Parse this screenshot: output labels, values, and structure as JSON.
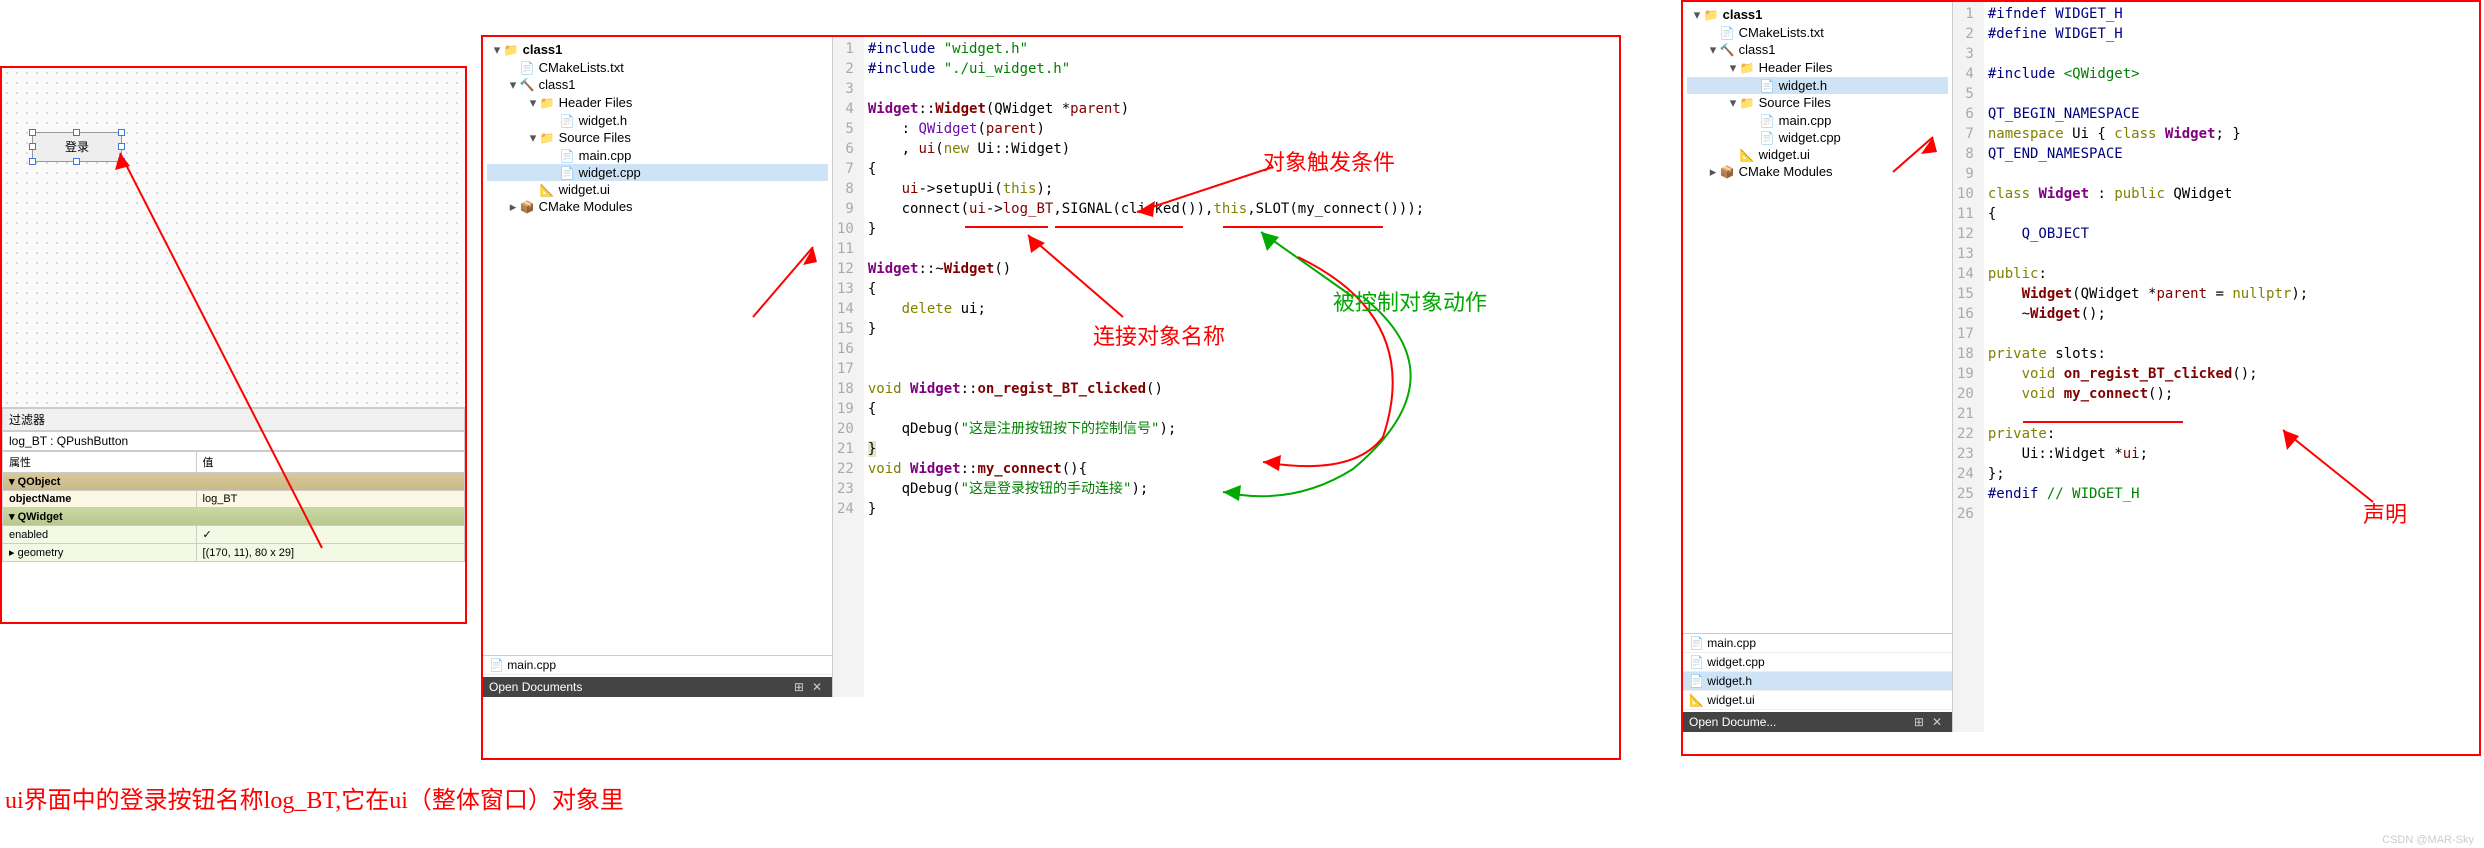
{
  "panel1": {
    "login_btn": "登录",
    "filter_label": "过滤器",
    "obj_line": "log_BT : QPushButton",
    "header_prop": "属性",
    "header_val": "值",
    "section_qobject": "QObject",
    "objectName_label": "objectName",
    "objectName_value": "log_BT",
    "section_qwidget": "QWidget",
    "enabled_label": "enabled",
    "enabled_value": "✓",
    "geometry_label": "geometry",
    "geometry_value": "[(170, 11), 80 x 29]"
  },
  "tree2": {
    "root": "class1",
    "cmakelists": "CMakeLists.txt",
    "sub": "class1",
    "headers": "Header Files",
    "widget_h": "widget.h",
    "sources": "Source Files",
    "main_cpp": "main.cpp",
    "widget_cpp": "widget.cpp",
    "widget_ui": "widget.ui",
    "cmake_modules": "CMake Modules"
  },
  "code_cpp": {
    "lines_gutter": "1\n2\n3\n4\n5\n6\n7\n8\n9\n10\n11\n12\n13\n14\n15\n16\n17\n18\n19\n20\n21\n22\n23\n24",
    "l1a": "#include ",
    "l1b": "\"widget.h\"",
    "l2a": "#include ",
    "l2b": "\"./ui_widget.h\"",
    "l4a": "Widget",
    "l4b": "::",
    "l4c": "Widget",
    "l4d": "(QWidget *",
    "l4e": "parent",
    "l4f": ")",
    "l5a": "    : ",
    "l5b": "QWidget",
    "l5c": "(",
    "l5d": "parent",
    "l5e": ")",
    "l6a": "    , ",
    "l6b": "ui",
    "l6c": "(",
    "l6d": "new",
    "l6e": " Ui::Widget)",
    "l7": "{",
    "l8a": "    ",
    "l8b": "ui",
    "l8c": "->setupUi(",
    "l8d": "this",
    "l8e": ");",
    "l9a": "    connect(",
    "l9b": "ui",
    "l9c": "->",
    "l9d": "log_BT",
    "l9e": ",SIGNAL(clicked()),",
    "l9f": "this",
    "l9g": ",SLOT(my_connect()));",
    "l10": "}",
    "l12a": "Widget",
    "l12b": "::~",
    "l12c": "Widget",
    "l12d": "()",
    "l13": "{",
    "l14a": "    ",
    "l14b": "delete",
    "l14c": " ui;",
    "l15": "}",
    "l18a": "void ",
    "l18b": "Widget",
    "l18c": "::",
    "l18d": "on_regist_BT_clicked",
    "l18e": "()",
    "l19": "{",
    "l20a": "    qDebug(",
    "l20b": "\"这是注册按钮按下的控制信号\"",
    "l20c": ");",
    "l21": "}",
    "l22a": "void ",
    "l22b": "Widget",
    "l22c": "::",
    "l22d": "my_connect",
    "l22e": "(){",
    "l23a": "    qDebug(",
    "l23b": "\"这是登录按钮的手动连接\"",
    "l23c": ");",
    "l24": "}"
  },
  "code_h": {
    "lines_gutter": "1\n2\n3\n4\n5\n6\n7\n8\n9\n10\n11\n12\n13\n14\n15\n16\n17\n18\n19\n20\n21\n22\n23\n24\n25\n26",
    "l1a": "#ifndef ",
    "l1b": "WIDGET_H",
    "l2a": "#define ",
    "l2b": "WIDGET_H",
    "l4a": "#include ",
    "l4b": "<QWidget>",
    "l6": "QT_BEGIN_NAMESPACE",
    "l7a": "namespace",
    "l7b": " Ui { ",
    "l7c": "class",
    "l7d": " ",
    "l7e": "Widget",
    "l7f": "; }",
    "l8": "QT_END_NAMESPACE",
    "l10a": "class",
    "l10b": " ",
    "l10c": "Widget",
    "l10d": " : ",
    "l10e": "public",
    "l10f": " QWidget",
    "l11": "{",
    "l12": "    Q_OBJECT",
    "l14a": "public",
    "l14b": ":",
    "l15a": "    ",
    "l15b": "Widget",
    "l15c": "(QWidget *",
    "l15d": "parent",
    "l15e": " = ",
    "l15f": "nullptr",
    "l15g": ");",
    "l16a": "    ~",
    "l16b": "Widget",
    "l16c": "();",
    "l18a": "private",
    "l18b": " slots:",
    "l19a": "    ",
    "l19b": "void",
    "l19c": " ",
    "l19d": "on_regist_BT_clicked",
    "l19e": "();",
    "l20a": "    ",
    "l20b": "void",
    "l20c": " ",
    "l20d": "my_connect",
    "l20e": "();",
    "l22a": "private",
    "l22b": ":",
    "l23a": "    Ui::Widget *",
    "l23b": "ui",
    "l23c": ";",
    "l24": "};",
    "l25a": "#endif ",
    "l25b": "// WIDGET_H"
  },
  "opendocs": {
    "title": "Open Documents",
    "title_short": "Open Docume...",
    "main_cpp": "main.cpp",
    "widget_cpp": "widget.cpp",
    "widget_h": "widget.h",
    "widget_ui": "widget.ui"
  },
  "annotations": {
    "obj_trigger": "对象触发条件",
    "connect_name": "连接对象名称",
    "controlled_action": "被控制对象动作",
    "declaration": "声明",
    "caption": "ui界面中的登录按钮名称log_BT,它在ui（整体窗口）对象里"
  },
  "watermark": "CSDN @MAR-Sky"
}
